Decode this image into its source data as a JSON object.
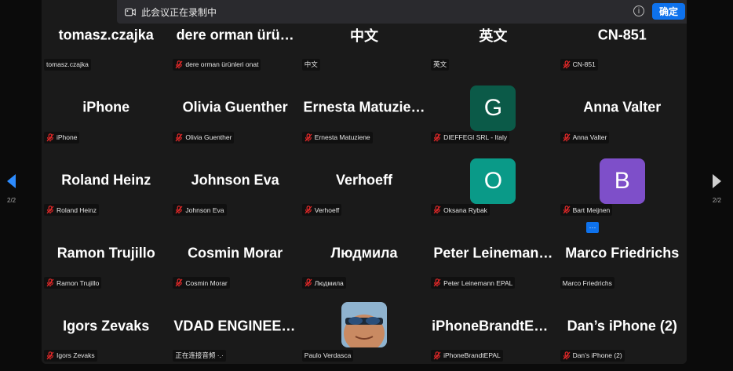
{
  "banner": {
    "message": "此会议正在录制中",
    "ok_label": "确定"
  },
  "navigation": {
    "page_left": "2/2",
    "page_right": "2/2"
  },
  "colors": {
    "accent": "#0e72ed",
    "muted_mic": "#e02828",
    "avatar_G": "#0b5a48",
    "avatar_O": "#0a9a88",
    "avatar_B": "#7e4fc9"
  },
  "tiles": [
    {
      "name": "tomasz.czajka",
      "label": "tomasz.czajka",
      "muted": false
    },
    {
      "name": "dere orman ürü…",
      "label": "dere orman ürünleri onat",
      "muted": true
    },
    {
      "name": "中文",
      "label": "中文",
      "muted": false
    },
    {
      "name": "英文",
      "label": "英文",
      "muted": false
    },
    {
      "name": "CN-851",
      "label": "CN-851",
      "muted": true
    },
    {
      "name": "iPhone",
      "label": "iPhone",
      "muted": true
    },
    {
      "name": "Olivia Guenther",
      "label": "Olivia Guenther",
      "muted": true
    },
    {
      "name": "Ernesta  Matuzie…",
      "label": "Ernesta Matuzienе",
      "muted": true
    },
    {
      "avatar": "G",
      "color": "#0b5a48",
      "label": "DIEFFEGI SRL - Italy",
      "muted": true
    },
    {
      "name": "Anna Valter",
      "label": "Anna Valter",
      "muted": true
    },
    {
      "name": "Roland Heinz",
      "label": "Roland Heinz",
      "muted": true
    },
    {
      "name": "Johnson Eva",
      "label": "Johnson Eva",
      "muted": true
    },
    {
      "name": "Verhoeff",
      "label": "Verhoeff",
      "muted": true
    },
    {
      "avatar": "O",
      "color": "#0a9a88",
      "label": "Oksana Rybak",
      "muted": true
    },
    {
      "avatar": "B",
      "color": "#7e4fc9",
      "label": "Bart Meijnen",
      "muted": true
    },
    {
      "name": "Ramon Trujillo",
      "label": "Ramon Trujillo",
      "muted": true
    },
    {
      "name": "Cosmin Morar",
      "label": "Cosmin Morar",
      "muted": true
    },
    {
      "name": "Людмила",
      "label": "Людмила",
      "muted": true
    },
    {
      "name": "Peter  Leineman…",
      "label": "Peter Leinemann EPAL",
      "muted": true
    },
    {
      "name": "Marco Friedrichs",
      "label": "Marco Friedrichs",
      "muted": false
    },
    {
      "name": "Igors Zevaks",
      "label": "Igors Zevaks",
      "muted": true
    },
    {
      "name": "VDAD ENGINEERS",
      "label": "正在连接音频 ·.·",
      "muted": false
    },
    {
      "photo": true,
      "label": "Paulo Verdasca",
      "muted": false
    },
    {
      "name": "iPhoneBrandtEP…",
      "label": "iPhoneBrandtEPAL",
      "muted": true
    },
    {
      "name": "Dan’s iPhone (2)",
      "label": "Dan’s iPhone (2)",
      "muted": true
    }
  ]
}
